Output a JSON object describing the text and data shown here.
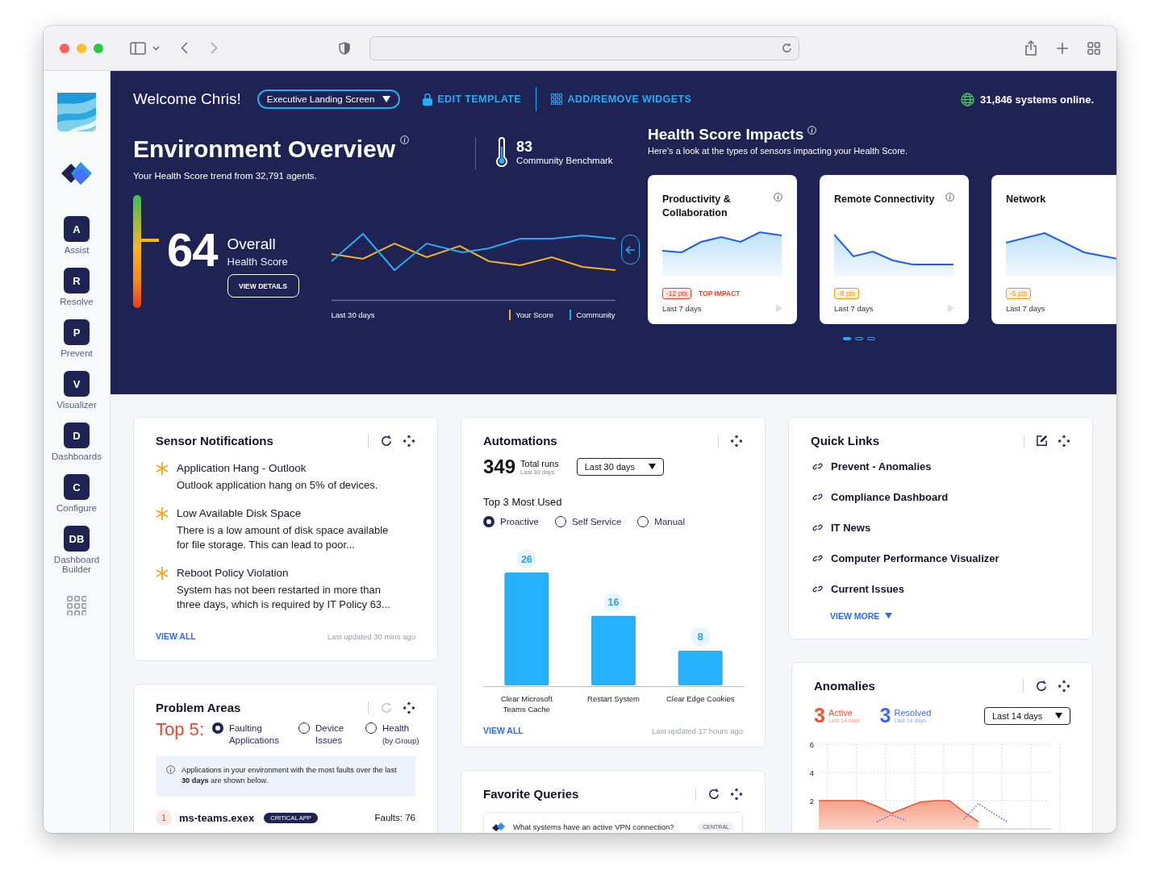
{
  "sidebar": {
    "items": [
      {
        "letter": "A",
        "label": "Assist"
      },
      {
        "letter": "R",
        "label": "Resolve"
      },
      {
        "letter": "P",
        "label": "Prevent"
      },
      {
        "letter": "V",
        "label": "Visualizer"
      },
      {
        "letter": "D",
        "label": "Dashboards"
      },
      {
        "letter": "C",
        "label": "Configure"
      },
      {
        "letter": "DB",
        "label": "Dashboard Builder"
      }
    ]
  },
  "header": {
    "greeting": "Welcome Chris!",
    "template_select": "Executive Landing Screen",
    "actions": [
      {
        "kind": "lock",
        "label": "EDIT TEMPLATE"
      },
      {
        "kind": "grid",
        "label": "ADD/REMOVE WIDGETS"
      }
    ],
    "status": "31,846 systems online."
  },
  "overview": {
    "title": "Environment Overview",
    "subtitle": "Your Health Score trend from 32,791 agents.",
    "benchmark_value": "83",
    "benchmark_label": "Community Benchmark",
    "score": "64",
    "score_gauge": {
      "level": 0.6
    },
    "score_label": "Overall",
    "score_sublabel": "Health Score",
    "details_button": "VIEW DETAILS",
    "trend_period": "Last 30 days",
    "legend": [
      {
        "name": "Your Score",
        "color": "#f5b324"
      },
      {
        "name": "Community",
        "color": "#29aaf4"
      }
    ]
  },
  "impacts": {
    "title": "Health Score Impacts",
    "subtitle": "Here’s a look at the types of sensors impacting your Health Score.",
    "cards": [
      {
        "title": "Productivity & Collaboration",
        "badge": "-12 pts",
        "color": "#e8452c",
        "tag": "TOP IMPACT",
        "period": "Last 7 days"
      },
      {
        "title": "Remote Connectivity",
        "badge": "-8 pts",
        "color": "#e89a12",
        "period": "Last 7 days"
      },
      {
        "title": "Network",
        "badge": "-5 pts",
        "color": "#e89a12",
        "period": "Last 7 days"
      }
    ],
    "pages": [
      {
        "selected": true
      },
      {
        "selected": false
      },
      {
        "selected": false
      }
    ]
  },
  "sensor_notifications": {
    "title": "Sensor Notifications",
    "items": [
      {
        "title": "Application Hang - Outlook",
        "text": "Outlook application hang on 5% of devices."
      },
      {
        "title": "Low Available Disk Space",
        "text": "There is a low amount of disk space available for file storage. This can lead to poor..."
      },
      {
        "title": "Reboot Policy Violation",
        "text": "System has not been restarted in more than three days, which is required by IT Policy 63..."
      }
    ],
    "link": "VIEW ALL",
    "updated": "Last updated 30 mins ago"
  },
  "problem_areas": {
    "title": "Problem Areas",
    "refresh_disabled": true,
    "top_label": "Top 5:",
    "options": [
      {
        "label": "Faulting Applications",
        "selected": true
      },
      {
        "label": "Device Issues",
        "selected": false
      },
      {
        "label": "Health",
        "note": "(by Group)",
        "selected": false
      }
    ],
    "notice": "Applications in your environment with the most faults over the last **30 days** are shown below.",
    "rows": [
      {
        "rank": "1",
        "name": "ms-teams.exex",
        "tag": "CRITICAL APP",
        "faults": "Faults: 76"
      }
    ]
  },
  "automations": {
    "title": "Automations",
    "total": "349",
    "total_label": "Total runs",
    "total_period": "Last 30 days",
    "period_select": "Last 30 days",
    "subtitle": "Top 3 Most Used",
    "options": [
      {
        "label": "Proactive",
        "selected": true
      },
      {
        "label": "Self Service",
        "selected": false
      },
      {
        "label": "Manual",
        "selected": false
      }
    ],
    "chart_data": {
      "type": "bar",
      "categories": [
        "Clear Microsoft Teams Cache",
        "Restart System",
        "Clear Edge Cookies"
      ],
      "values": [
        26,
        16,
        8
      ],
      "data_labels": true
    },
    "link": "VIEW ALL",
    "updated": "Last updated 17 hours ago"
  },
  "favorite_queries": {
    "title": "Favorite Queries",
    "queries": [
      {
        "text": "What systems have an active VPN connection?",
        "tag": "CENTRAL"
      }
    ]
  },
  "quick_links": {
    "title": "Quick Links",
    "links": [
      "Prevent - Anomalies",
      "Compliance Dashboard",
      "IT News",
      "Computer Performance Visualizer",
      "Current Issues"
    ],
    "more": "VIEW MORE"
  },
  "anomalies": {
    "title": "Anomalies",
    "active_count": "3",
    "active_period": "Last 14 days",
    "resolved_count": "3",
    "resolved_period": "Last 14 days",
    "period_select": "Last 14 days",
    "chart_data": {
      "type": "area",
      "grid": true,
      "ylim": [
        0,
        6
      ],
      "yticks": [
        2,
        4,
        6
      ],
      "series": [
        {
          "name": "Active",
          "color": "#f0532d",
          "values": [
            2,
            2,
            2,
            2,
            1.6,
            1.1,
            1.5,
            1.9,
            2,
            2,
            1.2,
            0.5,
            null,
            null,
            null,
            null
          ]
        },
        {
          "name": "Resolved",
          "color": "#3d6bf5",
          "type": "line",
          "line_style": "dotted",
          "values": [
            null,
            null,
            null,
            null,
            0.5,
            1,
            0.6,
            null,
            null,
            null,
            0.7,
            1.8,
            1.1,
            0.5,
            null,
            null
          ]
        }
      ]
    }
  }
}
